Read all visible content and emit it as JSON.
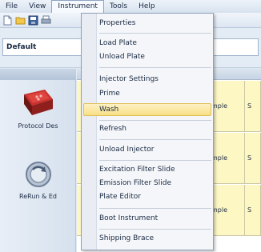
{
  "menubar": {
    "items": [
      {
        "label": "File"
      },
      {
        "label": "View"
      },
      {
        "label": "Instrument"
      },
      {
        "label": "Tools"
      },
      {
        "label": "Help"
      }
    ]
  },
  "profile": {
    "value": "Default"
  },
  "leftpanel": {
    "buttons": [
      {
        "label": "Protocol Des",
        "icon": "protocol-icon"
      },
      {
        "label": "ReRun & Ed",
        "icon": "rerun-icon"
      }
    ]
  },
  "grid": {
    "rows": [
      {
        "cell1": "mple",
        "cell2": "S"
      },
      {
        "cell1": "mple",
        "cell2": "S"
      },
      {
        "cell1": "mple",
        "cell2": "S"
      }
    ]
  },
  "dropdown": {
    "items": [
      {
        "label": "Properties"
      },
      {
        "label": "Load Plate"
      },
      {
        "label": "Unload Plate"
      },
      {
        "label": "Injector Settings"
      },
      {
        "label": "Prime"
      },
      {
        "label": "Wash",
        "highlighted": true
      },
      {
        "label": "Refresh"
      },
      {
        "label": "Unload Injector"
      },
      {
        "label": "Excitation Filter Slide"
      },
      {
        "label": "Emission Filter Slide"
      },
      {
        "label": "Plate Editor"
      },
      {
        "label": "Boot Instrument"
      },
      {
        "label": "Shipping Brace"
      }
    ]
  },
  "colors": {
    "highlight": "#f8df86",
    "grid_row": "#fdf7c4",
    "menu_bg": "#f4f6f9"
  }
}
